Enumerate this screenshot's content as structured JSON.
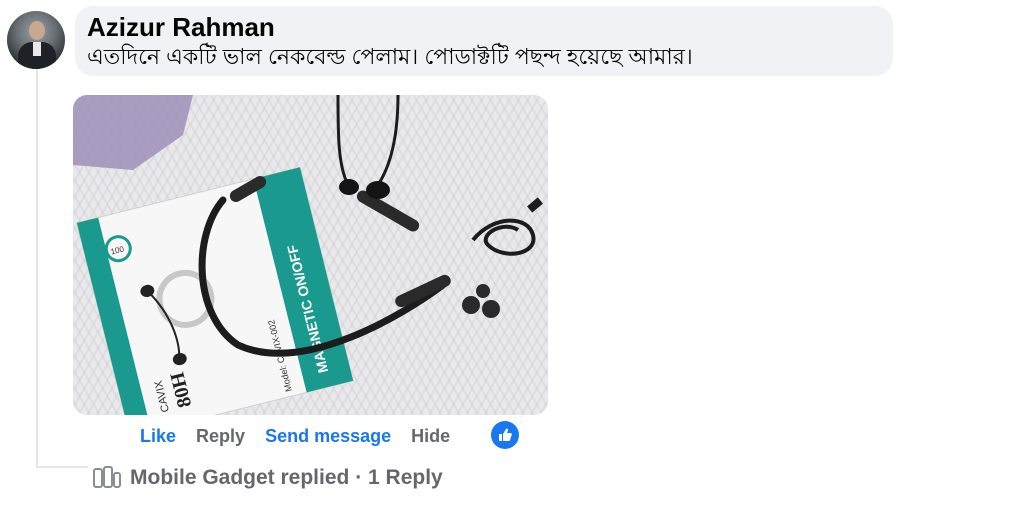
{
  "comment": {
    "author": "Azizur Rahman",
    "text": "এতদিনে একটি ভাল নেকবেল্ড পেলাম। পোডাক্টটি পছন্দ হয়েছে আমার।"
  },
  "photo": {
    "box_text": {
      "hours": "80H",
      "brand": "CAVIX",
      "model": "Model: CAVIX-002",
      "feature_magnetic": "MAGNETIC ON/OFF",
      "badge": "100"
    }
  },
  "actions": {
    "like": "Like",
    "reply": "Reply",
    "send_message": "Send message",
    "hide": "Hide"
  },
  "reply_summary": {
    "text": "Mobile Gadget replied · 1 Reply"
  },
  "colors": {
    "link_blue": "#1877f2",
    "muted_gray": "#65676b",
    "bubble_bg": "#f0f2f5",
    "box_teal": "#1a9a8e"
  },
  "icons": [
    "like-reaction-icon",
    "avatar",
    "reply-avatar-icon"
  ]
}
